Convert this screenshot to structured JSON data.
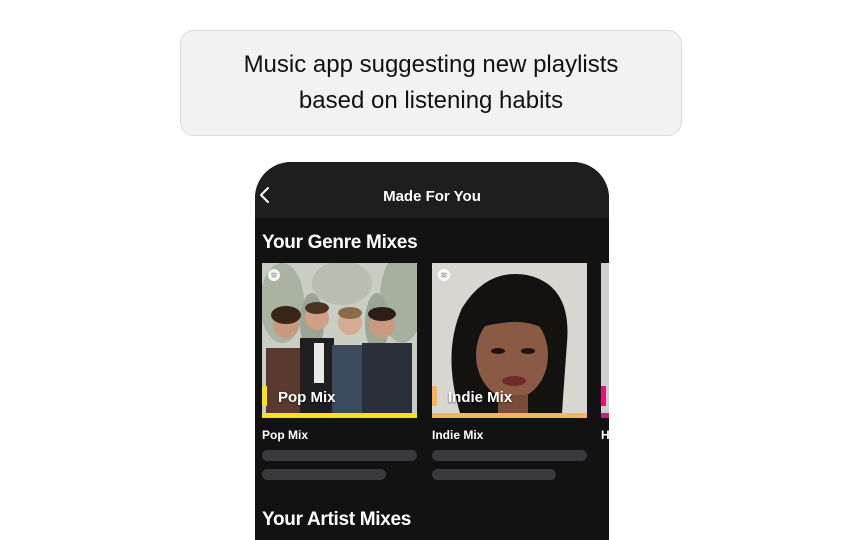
{
  "caption": {
    "line1": "Music app suggesting new playlists",
    "line2": "based on listening habits"
  },
  "header": {
    "title": "Made For You",
    "back_icon": "chevron-left-icon"
  },
  "sections": [
    {
      "title": "Your Genre Mixes"
    },
    {
      "title": "Your Artist Mixes"
    }
  ],
  "genre_mixes": [
    {
      "cover_label": "Pop Mix",
      "title": "Pop Mix",
      "accent": "#f5e21b"
    },
    {
      "cover_label": "Indie Mix",
      "title": "Indie Mix",
      "accent": "#f7b25a"
    },
    {
      "cover_label": "",
      "title": "H",
      "accent": "#e0157a"
    }
  ],
  "colors": {
    "background": "#121212",
    "header": "#1e1e1e",
    "skeleton": "#3a3a3e"
  }
}
